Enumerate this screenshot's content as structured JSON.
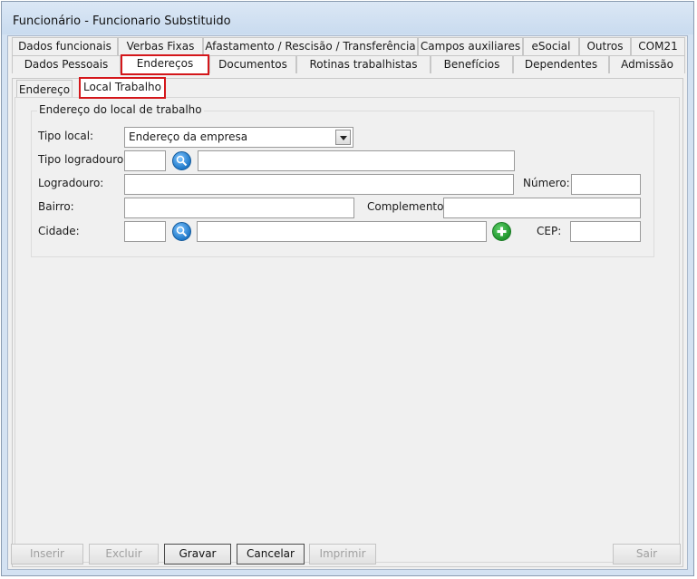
{
  "window": {
    "title": "Funcionário - Funcionario Substituido"
  },
  "tabs_row1": [
    {
      "label": "Dados funcionais"
    },
    {
      "label": "Verbas Fixas"
    },
    {
      "label": "Afastamento / Rescisão / Transferência"
    },
    {
      "label": "Campos auxiliares"
    },
    {
      "label": "eSocial"
    },
    {
      "label": "Outros"
    },
    {
      "label": "COM21"
    }
  ],
  "tabs_row2": [
    {
      "label": "Dados Pessoais"
    },
    {
      "label": "Endereços"
    },
    {
      "label": "Documentos"
    },
    {
      "label": "Rotinas trabalhistas"
    },
    {
      "label": "Benefícios"
    },
    {
      "label": "Dependentes"
    },
    {
      "label": "Admissão"
    }
  ],
  "subtabs": [
    {
      "label": "Endereço"
    },
    {
      "label": "Local Trabalho"
    }
  ],
  "group": {
    "title": "Endereço do local de trabalho",
    "tipo_local_label": "Tipo local:",
    "tipo_local_value": "Endereço da empresa",
    "tipo_logradouro_label": "Tipo logradouro:",
    "tipo_logradouro_code": "",
    "tipo_logradouro_desc": "",
    "logradouro_label": "Logradouro:",
    "logradouro_value": "",
    "numero_label": "Número:",
    "numero_value": "",
    "bairro_label": "Bairro:",
    "bairro_value": "",
    "complemento_label": "Complemento:",
    "complemento_value": "",
    "cidade_label": "Cidade:",
    "cidade_code": "",
    "cidade_desc": "",
    "cep_label": "CEP:",
    "cep_value": ""
  },
  "buttons": {
    "inserir": "Inserir",
    "excluir": "Excluir",
    "gravar": "Gravar",
    "cancelar": "Cancelar",
    "imprimir": "Imprimir",
    "sair": "Sair"
  },
  "icons": {
    "search": "magnifier-icon",
    "add": "plus-icon"
  },
  "colors": {
    "selected_outline": "#d4171b",
    "search_icon": "#1f78c8",
    "add_icon": "#21962e"
  }
}
